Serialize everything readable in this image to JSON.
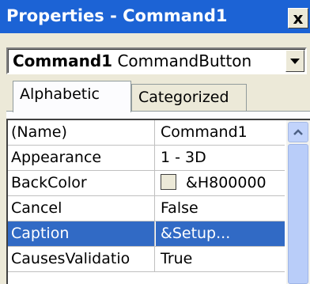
{
  "window": {
    "title": "Properties - Command1",
    "close_label": "x"
  },
  "object_selector": {
    "object_name": "Command1",
    "object_type": "CommandButton"
  },
  "tabs": [
    {
      "label": "Alphabetic",
      "active": true
    },
    {
      "label": "Categorized",
      "active": false
    }
  ],
  "properties": [
    {
      "name": "(Name)",
      "value": "Command1"
    },
    {
      "name": "Appearance",
      "value": "1 - 3D"
    },
    {
      "name": "BackColor",
      "value": "&H800000",
      "swatch_color": "#ece9d8"
    },
    {
      "name": "Cancel",
      "value": "False"
    },
    {
      "name": "Caption",
      "value": "&Setup...",
      "selected": true
    },
    {
      "name": "CausesValidatio",
      "value": "True"
    }
  ],
  "colors": {
    "titlebar": "#1c63d5",
    "selection": "#316ac5",
    "scrollbar_accent": "#c1d3fb"
  },
  "icons": {
    "close": "close-icon",
    "dropdown": "chevron-down-icon",
    "scroll_up": "chevron-up-icon"
  }
}
